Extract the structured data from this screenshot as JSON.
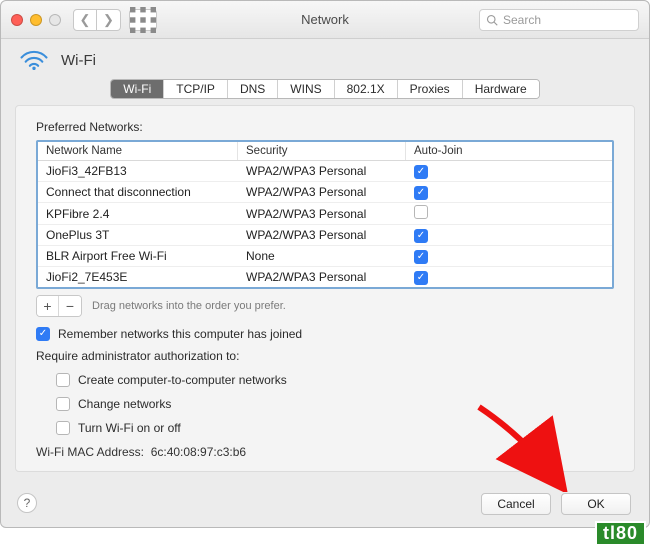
{
  "window": {
    "title": "Network"
  },
  "search": {
    "placeholder": "Search"
  },
  "header": {
    "name": "Wi-Fi"
  },
  "tabs": [
    "Wi-Fi",
    "TCP/IP",
    "DNS",
    "WINS",
    "802.1X",
    "Proxies",
    "Hardware"
  ],
  "active_tab": 0,
  "preferred_label": "Preferred Networks:",
  "columns": {
    "name": "Network Name",
    "security": "Security",
    "autojoin": "Auto-Join"
  },
  "networks": [
    {
      "name": "JioFi3_42FB13",
      "security": "WPA2/WPA3 Personal",
      "autojoin": true
    },
    {
      "name": "Connect that disconnection",
      "security": "WPA2/WPA3 Personal",
      "autojoin": true
    },
    {
      "name": "KPFibre 2.4",
      "security": "WPA2/WPA3 Personal",
      "autojoin": false
    },
    {
      "name": "OnePlus 3T",
      "security": "WPA2/WPA3 Personal",
      "autojoin": true
    },
    {
      "name": "BLR Airport Free Wi-Fi",
      "security": "None",
      "autojoin": true
    },
    {
      "name": "JioFi2_7E453E",
      "security": "WPA2/WPA3 Personal",
      "autojoin": true
    }
  ],
  "drag_hint": "Drag networks into the order you prefer.",
  "remember": {
    "label": "Remember networks this computer has joined",
    "checked": true
  },
  "admin_label": "Require administrator authorization to:",
  "admin_opts": [
    {
      "label": "Create computer-to-computer networks",
      "checked": false
    },
    {
      "label": "Change networks",
      "checked": false
    },
    {
      "label": "Turn Wi-Fi on or off",
      "checked": false
    }
  ],
  "mac": {
    "label": "Wi-Fi MAC Address:",
    "value": "6c:40:08:97:c3:b6"
  },
  "buttons": {
    "cancel": "Cancel",
    "ok": "OK"
  },
  "watermark": "tl80"
}
